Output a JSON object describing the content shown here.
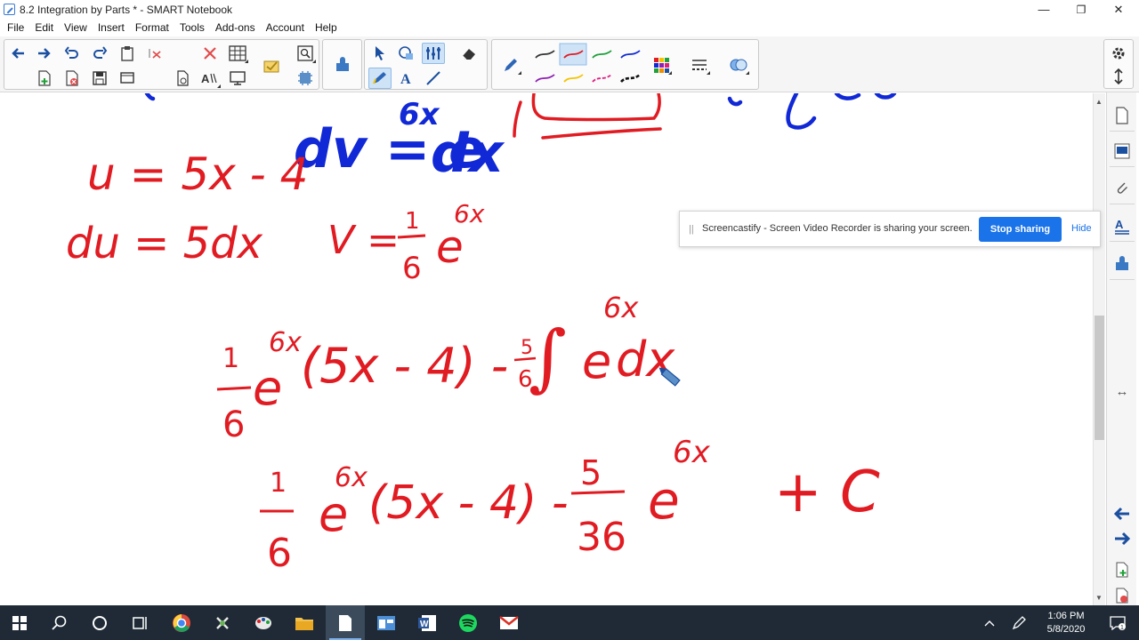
{
  "window": {
    "title": "8.2 Integration by Parts * - SMART Notebook",
    "min": "—",
    "max": "❐",
    "close": "✕"
  },
  "menu": [
    "File",
    "Edit",
    "View",
    "Insert",
    "Format",
    "Tools",
    "Add-ons",
    "Account",
    "Help"
  ],
  "colors": {
    "ink_red": "#e11b22",
    "ink_blue": "#1028d6",
    "accent": "#1a73e8",
    "taskbar": "#1f2a36"
  },
  "icons": {
    "toolbar": [
      "arrow-left-icon",
      "arrow-right-icon",
      "undo-icon",
      "redo-icon",
      "paste-icon",
      "delete-icon",
      "table-icon",
      "screen-shade-icon",
      "add-page-icon",
      "delete-page-icon",
      "save-icon",
      "full-screen-icon",
      "document-camera-icon",
      "spell-check-icon",
      "display-icon",
      "response-icon",
      "magic-wand-icon",
      "page-sorter-icon",
      "addons-icon",
      "select-icon",
      "shapes-icon",
      "measurement-icon",
      "pen-icon",
      "text-icon",
      "line-icon",
      "eraser-icon",
      "highlighter-icon",
      "color-palette-icon",
      "line-style-icon",
      "fill-icon"
    ],
    "side": [
      "page-sorter-icon",
      "gallery-icon",
      "attachments-icon",
      "properties-icon",
      "addons-icon"
    ]
  },
  "pen_colors": [
    "#333333",
    "#e11b22",
    "#1e9e3b",
    "#1028d6",
    "#8d1fb2",
    "#f2c400",
    "#e01e7e",
    "#111111"
  ],
  "banner": {
    "message": "Screencastify - Screen Video Recorder is sharing your screen.",
    "stop_label": "Stop sharing",
    "hide_label": "Hide",
    "grip": "||"
  },
  "board": {
    "line1_dv": "dv = e",
    "line1_dv_exp": "6x",
    "line1_dv_tail": "dx",
    "u_def": "u = 5x - 4",
    "du_def": "du = 5dx",
    "v_def_lhs": "V =",
    "v_num": "1",
    "v_den": "6",
    "v_e": "e",
    "v_exp": "6x",
    "l3_num": "1",
    "l3_den": "6",
    "l3_e": "e",
    "l3_exp": "6x",
    "l3_mid": "(5x - 4) -",
    "l3_fr_num": "5",
    "l3_fr_den": "6",
    "l3_int": "∫",
    "l3_tail_e": "e",
    "l3_tail_exp": "6x",
    "l3_tail_dx": "dx",
    "l4_num": "1",
    "l4_den": "6",
    "l4_e": "e",
    "l4_exp": "6x",
    "l4_mid": "(5x - 4) -",
    "l4_fr_num": "5",
    "l4_fr_den": "36",
    "l4_tail_e": "e",
    "l4_tail_exp": "6x",
    "l4_plus_c": "+ C"
  },
  "taskbar": {
    "time": "1:06 PM",
    "date": "5/8/2020"
  }
}
